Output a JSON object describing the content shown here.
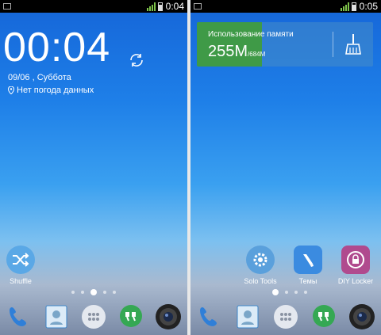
{
  "left": {
    "status": {
      "time": "0:04"
    },
    "clock": "00:04",
    "date": "09/06 , Суббота",
    "weather": "Нет погода данных",
    "apps": [
      {
        "label": "Shuffle"
      }
    ],
    "page_indicator": {
      "count": 5,
      "active": 2
    }
  },
  "right": {
    "status": {
      "time": "0:05"
    },
    "memory": {
      "title": "Использование памяти",
      "used": "255M",
      "total": "/684M",
      "fraction": 0.37
    },
    "apps": [
      {
        "label": "Solo Tools"
      },
      {
        "label": "Темы"
      },
      {
        "label": "DIY Locker"
      }
    ],
    "page_indicator": {
      "count": 4,
      "active": 0
    }
  },
  "dock": [
    "phone-icon",
    "contacts-icon",
    "app-drawer-icon",
    "hangouts-icon",
    "camera-icon"
  ],
  "colors": {
    "memory_fill": "#3f9a47",
    "solo_tools": "#5aa0dc",
    "themes": "#3b8be0",
    "diy_locker": "#b04a8e",
    "hangouts": "#35a853"
  }
}
